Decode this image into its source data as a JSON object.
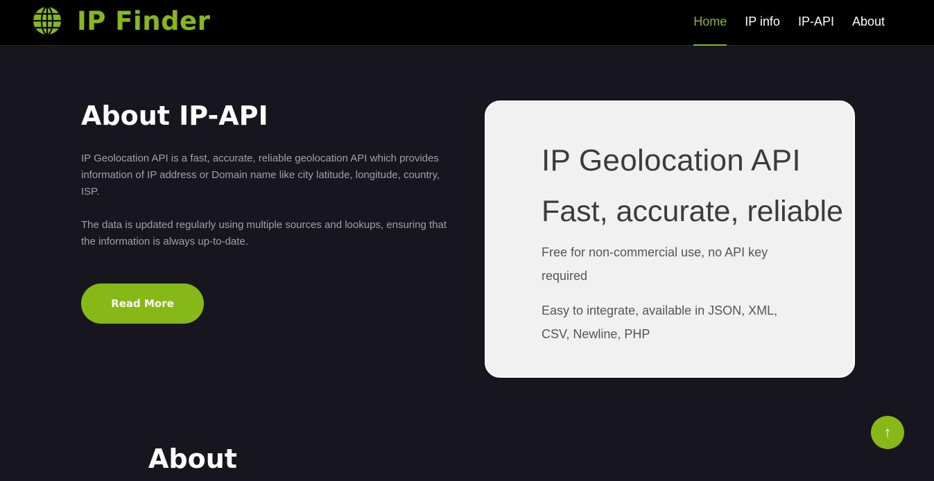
{
  "colors": {
    "accent": "#86b817",
    "background": "#17161f",
    "navbar": "#000000",
    "card": "#f1f1f1"
  },
  "navbar": {
    "brand": {
      "icon": "globe-icon",
      "name": "IP Finder"
    },
    "links": [
      {
        "label": "Home",
        "active": true
      },
      {
        "label": "IP info",
        "active": false
      },
      {
        "label": "IP-API",
        "active": false
      },
      {
        "label": "About",
        "active": false
      }
    ]
  },
  "about": {
    "title": "About IP-API",
    "paragraph1": "IP Geolocation API is a fast, accurate, reliable geolocation API which provides information of IP address or Domain name like city latitude, longitude, country, ISP.",
    "paragraph2": "The data is updated regularly using multiple sources and lookups, ensuring that the information is always up-to-date.",
    "read_more_label": "Read More"
  },
  "card": {
    "title": "IP Geolocation API",
    "subtitle": "Fast, accurate, reliable",
    "text1": "Free for non-commercial use, no API key required",
    "text2": "Easy to integrate, available in JSON, XML, CSV, Newline, PHP"
  },
  "section2": {
    "title": "About"
  },
  "back_to_top": {
    "icon": "arrow-up-icon",
    "glyph": "↑"
  }
}
